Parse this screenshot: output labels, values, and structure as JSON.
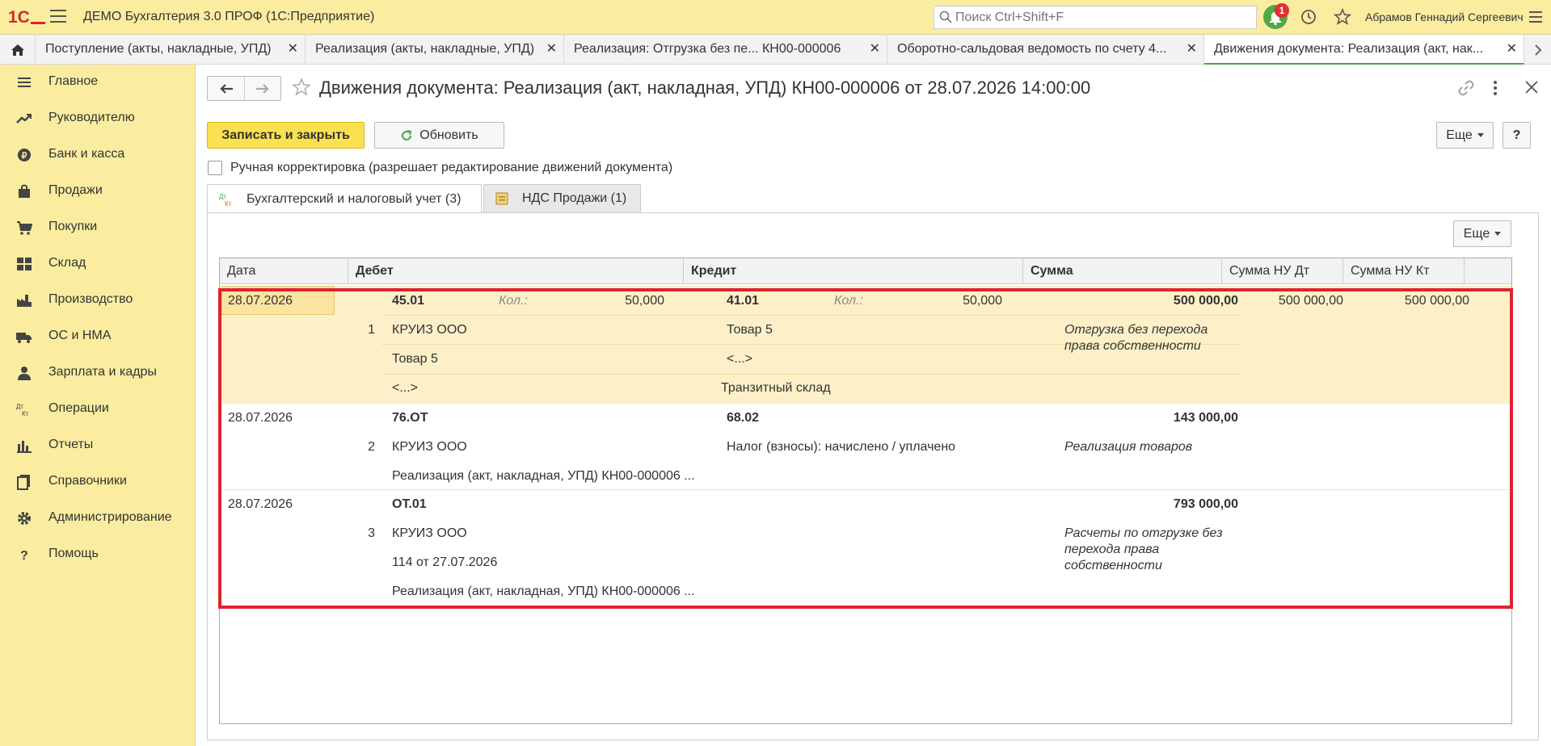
{
  "app": {
    "title": "ДЕМО Бухгалтерия 3.0 ПРОФ  (1С:Предприятие)",
    "search_placeholder": "Поиск Ctrl+Shift+F",
    "notifications_count": "1",
    "user": "Абрамов Геннадий Сергеевич"
  },
  "tabs": [
    {
      "label": "Поступление (акты, накладные, УПД)"
    },
    {
      "label": "Реализация (акты, накладные, УПД)"
    },
    {
      "label": "Реализация: Отгрузка без пе...   КН00-000006"
    },
    {
      "label": "Оборотно-сальдовая ведомость по счету 4..."
    },
    {
      "label": "Движения документа: Реализация (акт, нак..."
    }
  ],
  "sidebar": {
    "items": [
      {
        "label": "Главное",
        "icon": "menu-icon"
      },
      {
        "label": "Руководителю",
        "icon": "trend-icon"
      },
      {
        "label": "Банк и касса",
        "icon": "coin-icon"
      },
      {
        "label": "Продажи",
        "icon": "bag-icon"
      },
      {
        "label": "Покупки",
        "icon": "cart-icon"
      },
      {
        "label": "Склад",
        "icon": "warehouse-icon"
      },
      {
        "label": "Производство",
        "icon": "factory-icon"
      },
      {
        "label": "ОС и НМА",
        "icon": "truck-icon"
      },
      {
        "label": "Зарплата и кадры",
        "icon": "person-icon"
      },
      {
        "label": "Операции",
        "icon": "dt-kt-icon"
      },
      {
        "label": "Отчеты",
        "icon": "bar-chart-icon"
      },
      {
        "label": "Справочники",
        "icon": "book-icon"
      },
      {
        "label": "Администрирование",
        "icon": "gear-icon"
      },
      {
        "label": "Помощь",
        "icon": "help-icon"
      }
    ]
  },
  "document": {
    "title": "Движения документа: Реализация (акт, накладная, УПД) КН00-000006 от 28.07.2026 14:00:00",
    "save_close": "Записать и закрыть",
    "refresh": "Обновить",
    "more": "Еще",
    "help": "?",
    "manual_label": "Ручная корректировка (разрешает редактирование движений документа)",
    "tab_accounting": "Бухгалтерский и налоговый учет (3)",
    "tab_vat": "НДС Продажи (1)",
    "table_more": "Еще"
  },
  "table": {
    "headers": {
      "date": "Дата",
      "debit": "Дебет",
      "credit": "Кредит",
      "sum": "Сумма",
      "sum_nu_dt": "Сумма НУ Дт",
      "sum_nu_kt": "Сумма НУ Кт"
    },
    "rows": [
      {
        "date": "28.07.2026",
        "num": "1",
        "dt_account": "45.01",
        "dt_qty_label": "Кол.:",
        "dt_qty": "50,000",
        "dt_sub1": "КРУИЗ ООО",
        "dt_sub2": "Товар 5",
        "dt_sub3": "<...>",
        "kt_account": "41.01",
        "kt_qty_label": "Кол.:",
        "kt_qty": "50,000",
        "kt_sub1": "Товар 5",
        "kt_sub2": "<...>",
        "kt_sub3": "Транзитный склад",
        "sum": "500 000,00",
        "comment": "Отгрузка без перехода права собственности",
        "sum_nu_dt": "500 000,00",
        "sum_nu_kt": "500 000,00"
      },
      {
        "date": "28.07.2026",
        "num": "2",
        "dt_account": "76.ОТ",
        "dt_sub1": "КРУИЗ ООО",
        "dt_sub2": "Реализация (акт, накладная, УПД) КН00-000006 ...",
        "kt_account": "68.02",
        "kt_sub1": "Налог (взносы): начислено / уплачено",
        "sum": "143 000,00",
        "comment": "Реализация товаров"
      },
      {
        "date": "28.07.2026",
        "num": "3",
        "dt_account": "ОТ.01",
        "dt_sub1": "КРУИЗ ООО",
        "dt_sub2": "114 от 27.07.2026",
        "dt_sub3": "Реализация (акт, накладная, УПД) КН00-000006 ...",
        "sum": "793 000,00",
        "comment": "Расчеты по отгрузке без перехода права собственности"
      }
    ]
  },
  "colors": {
    "accent_yellow": "#fbeda0",
    "row_highlight": "#fdf0c8",
    "frame_red": "#e0232f",
    "primary_button": "#fbe150"
  }
}
